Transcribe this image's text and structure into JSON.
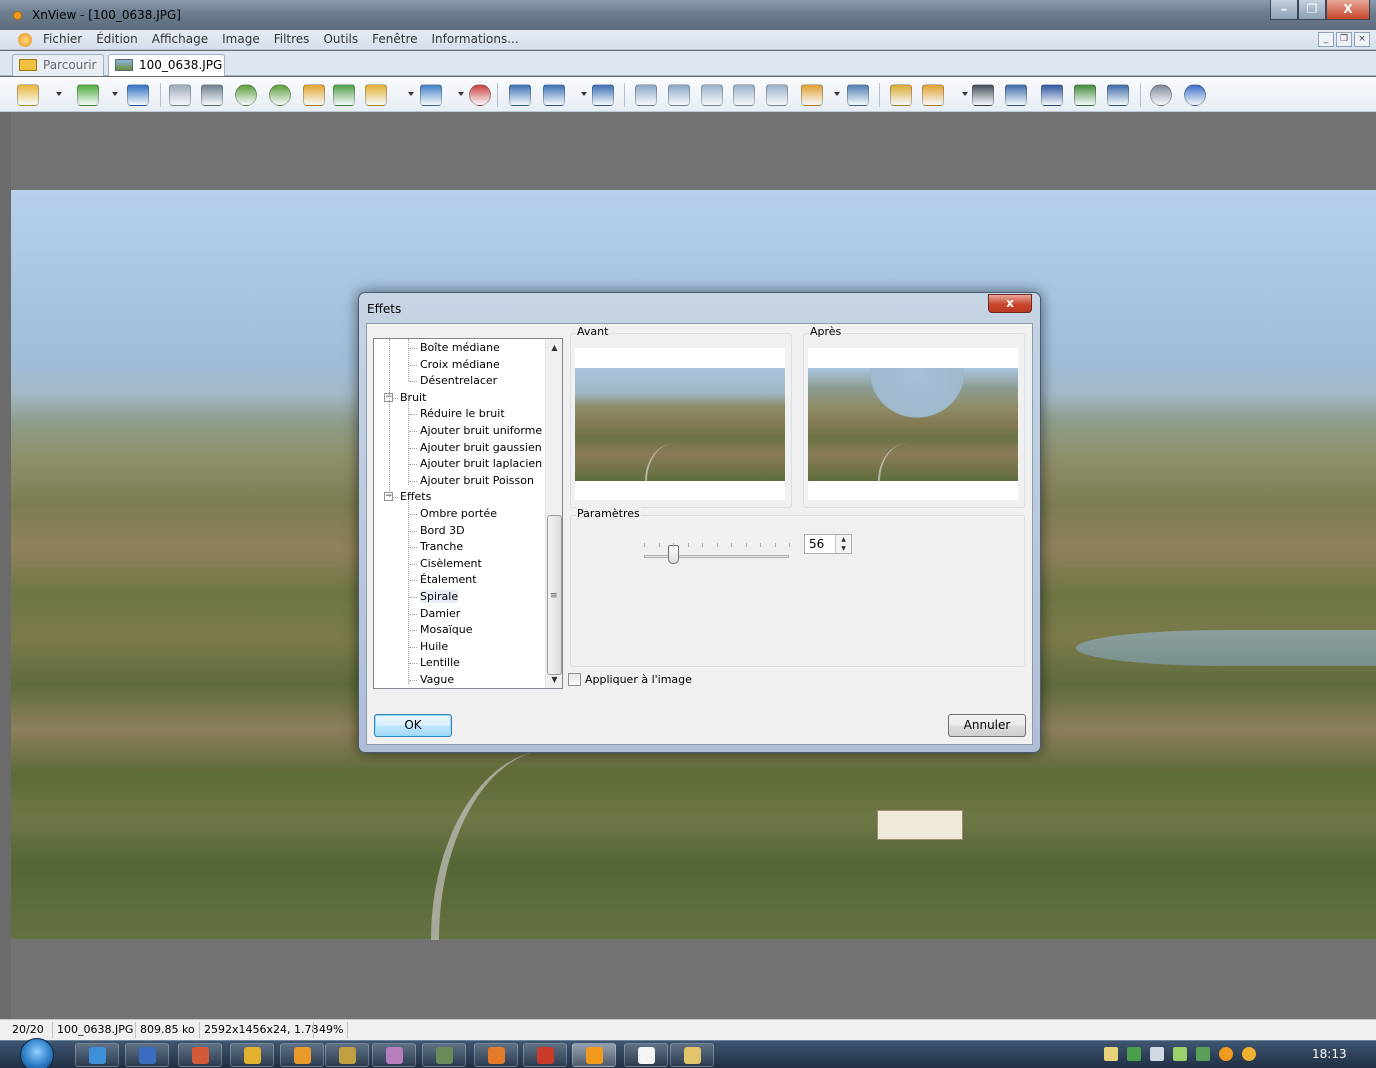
{
  "window": {
    "title": "XnView - [100_0638.JPG]",
    "buttons": {
      "minimize": "–",
      "maximize": "❐",
      "close": "X"
    }
  },
  "menubar": {
    "items": [
      "Fichier",
      "Édition",
      "Affichage",
      "Image",
      "Filtres",
      "Outils",
      "Fenêtre",
      "Informations..."
    ],
    "mdi": [
      "_",
      "❐",
      "×"
    ]
  },
  "tabs": [
    {
      "label": "Parcourir",
      "active": false
    },
    {
      "label": "100_0638.JPG",
      "active": true
    }
  ],
  "toolbar": {
    "icons": [
      "browse-icon",
      "open-icon",
      "save-icon",
      "undo-icon",
      "crop-icon",
      "rotate-left-icon",
      "rotate-right-icon",
      "flip-icon",
      "resize-icon",
      "adjust-icon",
      "palette-icon",
      "effects-icon",
      "zoom-in-icon",
      "zoom-icon",
      "zoom-out-icon",
      "previous-icon",
      "next-icon",
      "first-icon",
      "last-icon",
      "copy-icon",
      "slideshow-icon",
      "fullscreen-icon",
      "capture-icon",
      "export-icon",
      "find-icon",
      "print-icon",
      "scanner-icon",
      "batch-icon",
      "screenshot-icon",
      "settings-icon",
      "info-icon"
    ]
  },
  "dialog": {
    "title": "Effets",
    "close": "x",
    "tree": [
      {
        "label": "Boîte médiane",
        "level": 2
      },
      {
        "label": "Croix médiane",
        "level": 2
      },
      {
        "label": "Désentrelacer",
        "level": 2
      },
      {
        "label": "Bruit",
        "level": 1,
        "expander": "−"
      },
      {
        "label": "Réduire le bruit",
        "level": 2
      },
      {
        "label": "Ajouter bruit uniforme",
        "level": 2
      },
      {
        "label": "Ajouter bruit gaussien",
        "level": 2
      },
      {
        "label": "Ajouter bruit laplacien",
        "level": 2
      },
      {
        "label": "Ajouter bruit Poisson",
        "level": 2
      },
      {
        "label": "Effets",
        "level": 1,
        "expander": "−"
      },
      {
        "label": "Ombre portée",
        "level": 2
      },
      {
        "label": "Bord 3D",
        "level": 2
      },
      {
        "label": "Tranche",
        "level": 2
      },
      {
        "label": "Cisèlement",
        "level": 2
      },
      {
        "label": "Étalement",
        "level": 2
      },
      {
        "label": "Spirale",
        "level": 2,
        "selected": true
      },
      {
        "label": "Damier",
        "level": 2
      },
      {
        "label": "Mosaïque",
        "level": 2
      },
      {
        "label": "Huile",
        "level": 2
      },
      {
        "label": "Lentille",
        "level": 2
      },
      {
        "label": "Vague",
        "level": 2
      }
    ],
    "before_label": "Avant",
    "after_label": "Après",
    "params_label": "Paramètres",
    "slider_value": "56",
    "slider_fraction": 0.2,
    "apply_label": "Appliquer à l'image",
    "ok_label": "OK",
    "cancel_label": "Annuler"
  },
  "statusbar": {
    "index": "20/20",
    "filename": "100_0638.JPG",
    "size": "809.85 ko",
    "dimensions": "2592x1456x24, 1.78",
    "zoom": "49%"
  },
  "taskbar": {
    "apps": [
      "internet-explorer",
      "word",
      "paint",
      "chrome",
      "xnview-alt",
      "archive",
      "picture-viewer",
      "game",
      "firefox",
      "acrobat",
      "xnview",
      "notepad",
      "explorer"
    ],
    "active_index": 10,
    "tray": [
      "mail-icon",
      "network-icon",
      "volume-icon",
      "signal-icon",
      "battery-icon",
      "antivirus-icon",
      "update-icon"
    ],
    "clock": "18:13"
  }
}
